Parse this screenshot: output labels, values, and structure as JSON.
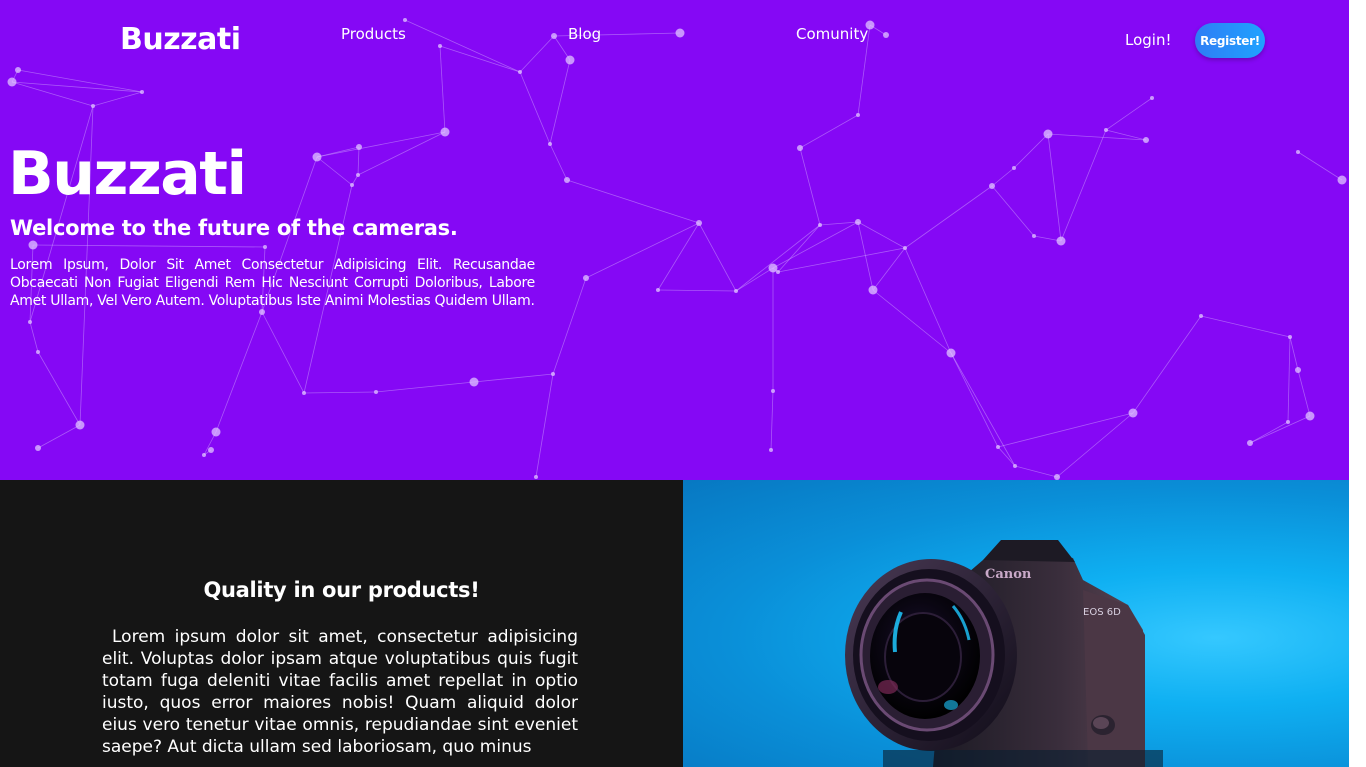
{
  "nav": {
    "logo": "Buzzati",
    "links": [
      "Products",
      "Blog",
      "Comunity"
    ],
    "login": "Login!",
    "register": "Register!"
  },
  "hero": {
    "title": "Buzzati",
    "subtitle": "Welcome to the future of the cameras.",
    "body": "Lorem Ipsum, Dolor Sit Amet Consectetur Adipisicing Elit. Recusandae Obcaecati Non Fugiat Eligendi Rem Hic Nesciunt Corrupti Doloribus, Labore Amet Ullam, Vel Vero Autem. Voluptatibus Iste Animi Molestias Quidem Ullam."
  },
  "feature": {
    "title": "Quality in our products!",
    "body": "Lorem ipsum dolor sit amet, consectetur adipisicing elit. Voluptas dolor ipsam atque voluptatibus quis fugit totam fuga deleniti vitae facilis amet repellat in optio iusto, quos error maiores nobis! Quam aliquid dolor eius vero tenetur vitae omnis, repudiandae sint eveniet saepe? Aut dicta ullam sed laboriosam, quo minus"
  },
  "camera": {
    "brand": "Canon",
    "model": "EOS 6D"
  },
  "colors": {
    "hero_bg": "#8508f5",
    "feature_bg": "#151515",
    "register_button": "#1fa2ff",
    "camera_bg": "#0fb0f2"
  },
  "icons": {
    "scroll_up": "triangle-up-icon",
    "scroll_down": "triangle-down-icon"
  }
}
